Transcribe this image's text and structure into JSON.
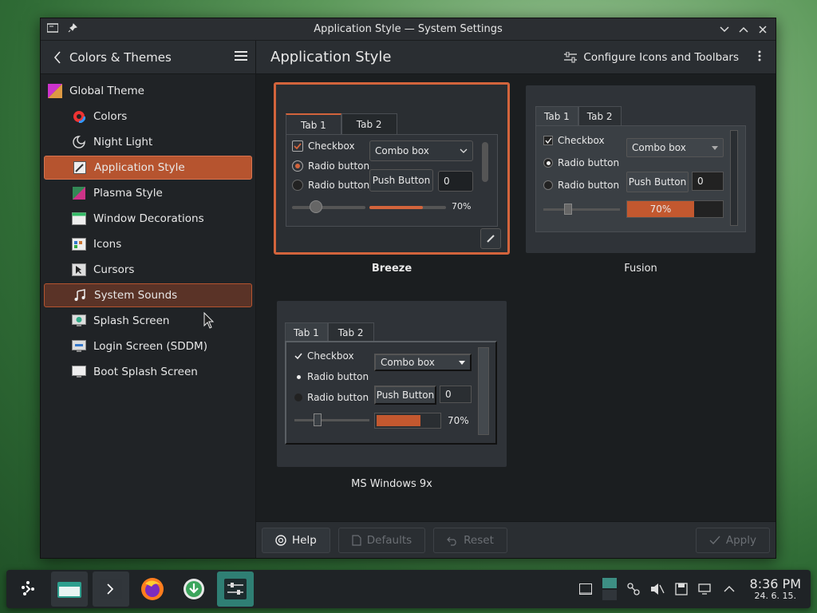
{
  "window": {
    "title": "Application Style — System Settings"
  },
  "sidebar": {
    "header": "Colors & Themes",
    "items": [
      {
        "label": "Global Theme",
        "icon": "global-theme-icon",
        "level": 0,
        "state": "normal"
      },
      {
        "label": "Colors",
        "icon": "colors-icon",
        "level": 1,
        "state": "normal"
      },
      {
        "label": "Night Light",
        "icon": "night-light-icon",
        "level": 1,
        "state": "normal"
      },
      {
        "label": "Application Style",
        "icon": "application-style-icon",
        "level": 1,
        "state": "active"
      },
      {
        "label": "Plasma Style",
        "icon": "plasma-style-icon",
        "level": 1,
        "state": "normal"
      },
      {
        "label": "Window Decorations",
        "icon": "window-decorations-icon",
        "level": 1,
        "state": "normal"
      },
      {
        "label": "Icons",
        "icon": "icons-icon",
        "level": 1,
        "state": "normal"
      },
      {
        "label": "Cursors",
        "icon": "cursors-icon",
        "level": 1,
        "state": "normal"
      },
      {
        "label": "System Sounds",
        "icon": "music-note-icon",
        "level": 1,
        "state": "hover"
      },
      {
        "label": "Splash Screen",
        "icon": "splash-screen-icon",
        "level": 1,
        "state": "normal"
      },
      {
        "label": "Login Screen (SDDM)",
        "icon": "login-screen-icon",
        "level": 1,
        "state": "normal"
      },
      {
        "label": "Boot Splash Screen",
        "icon": "boot-splash-icon",
        "level": 1,
        "state": "normal"
      }
    ]
  },
  "main": {
    "title": "Application Style",
    "configure_label": "Configure Icons and Toolbars"
  },
  "styles": [
    {
      "name": "Breeze",
      "selected": true
    },
    {
      "name": "Fusion",
      "selected": false
    },
    {
      "name": "MS Windows 9x",
      "selected": false
    }
  ],
  "preview_widgets": {
    "tab1": "Tab 1",
    "tab2": "Tab 2",
    "checkbox": "Checkbox",
    "radio": "Radio button",
    "combo": "Combo box",
    "push": "Push Button",
    "spin": "0",
    "progress": "70%",
    "progress_value": 0.7
  },
  "footer": {
    "help": "Help",
    "defaults": "Defaults",
    "reset": "Reset",
    "apply": "Apply"
  },
  "clock": {
    "time": "8:36 PM",
    "date": "24. 6. 15."
  },
  "colors": {
    "accent": "#b6542f"
  }
}
